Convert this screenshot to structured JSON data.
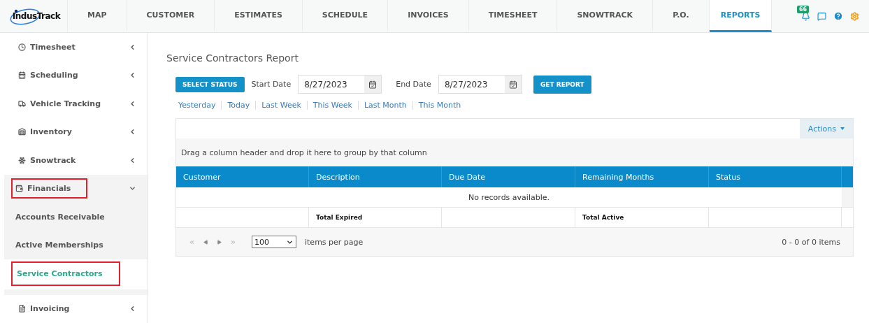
{
  "nav": {
    "logo": "IndusTrack",
    "tabs": [
      {
        "label": "MAP",
        "selected": false
      },
      {
        "label": "CUSTOMER",
        "selected": false
      },
      {
        "label": "ESTIMATES",
        "selected": false
      },
      {
        "label": "SCHEDULE",
        "selected": false
      },
      {
        "label": "INVOICES",
        "selected": false
      },
      {
        "label": "TIMESHEET",
        "selected": false
      },
      {
        "label": "SNOWTRACK",
        "selected": false
      },
      {
        "label": "P.O.",
        "selected": false
      },
      {
        "label": "REPORTS",
        "selected": true
      }
    ],
    "notification_count": "66"
  },
  "sidebar": {
    "items": [
      {
        "label": "Timesheet",
        "expanded": false,
        "highlighted": false
      },
      {
        "label": "Scheduling",
        "expanded": false,
        "highlighted": false
      },
      {
        "label": "Vehicle Tracking",
        "expanded": false,
        "highlighted": false
      },
      {
        "label": "Inventory",
        "expanded": false,
        "highlighted": false
      },
      {
        "label": "Snowtrack",
        "expanded": false,
        "highlighted": false
      },
      {
        "label": "Financials",
        "expanded": true,
        "highlighted": true,
        "children": [
          {
            "label": "Accounts Receivable",
            "selected": false,
            "highlighted": false
          },
          {
            "label": "Active Memberships",
            "selected": false,
            "highlighted": false
          },
          {
            "label": "Service Contractors",
            "selected": true,
            "highlighted": true
          }
        ]
      },
      {
        "label": "Invoicing",
        "expanded": false,
        "highlighted": false
      }
    ]
  },
  "report": {
    "title": "Service Contractors Report",
    "status_button": "SELECT STATUS",
    "start_label": "Start Date",
    "start_value": "8/27/2023",
    "end_label": "End Date",
    "end_value": "8/27/2023",
    "submit_button": "GET REPORT",
    "quick_ranges": [
      "Yesterday",
      "Today",
      "Last Week",
      "This Week",
      "Last Month",
      "This Month"
    ]
  },
  "grid": {
    "actions": "Actions",
    "group_hint": "Drag a column header and drop it here to group by that column",
    "columns": [
      {
        "label": "Customer"
      },
      {
        "label": "Description",
        "footer": "Total Expired"
      },
      {
        "label": "Due Date"
      },
      {
        "label": "Remaining Months",
        "footer": "Total Active"
      },
      {
        "label": "Status"
      }
    ],
    "empty_message": "No records available.",
    "page_size": "100",
    "page_size_label": "items per page",
    "pager_info": "0 - 0 of 0 items"
  }
}
